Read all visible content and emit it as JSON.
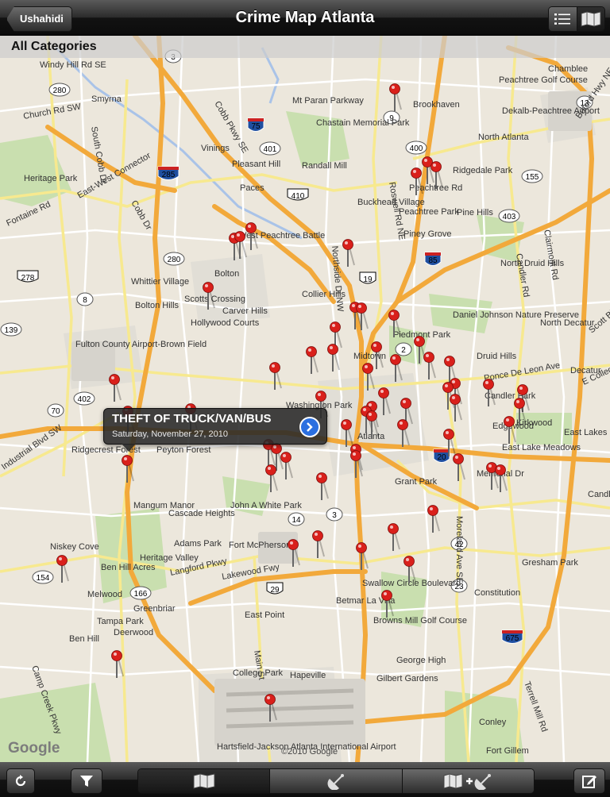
{
  "navbar": {
    "back_label": "Ushahidi",
    "title": "Crime Map Atlanta"
  },
  "category_bar": {
    "label": "All Categories"
  },
  "callout": {
    "title": "THEFT OF TRUCK/VAN/BUS",
    "date": "Saturday, November 27, 2010"
  },
  "map": {
    "attribution_logo": "Google",
    "copyright": "©2010 Google",
    "place_labels": [
      "Smyrna",
      "Vinings",
      "Chamblee",
      "Peachtree Golf Course",
      "Dekalb-Peachtree Airport",
      "Brookhaven",
      "North Atlanta",
      "Ridgedale Park",
      "Pine Hills",
      "Peachtree Park",
      "Piney Grove",
      "Mt Paran Parkway",
      "Chastain Memorial Park",
      "Randall Mill",
      "Pleasant Hill",
      "Paces",
      "Buckhead Village",
      "Heritage Park",
      "West Peachtree Battle",
      "Bolton",
      "North Druid Hills",
      "Whittier Village",
      "Bolton Hills",
      "Scotts Crossing",
      "Carver Hills",
      "Hollywood Courts",
      "Collier Hills",
      "Daniel Johnson Nature Preserve",
      "Piedmont Park",
      "North Decatur",
      "Druid Hills",
      "Decatur",
      "Fulton County Airport-Brown Field",
      "Midtown",
      "Candler Park",
      "Kirkwood",
      "Edgewood",
      "East Lakes",
      "East Lake Meadows",
      "Atlanta",
      "Washington Park",
      "Ridgecrest Forest",
      "Peyton Forest",
      "Grant Park",
      "John A White Park",
      "Cascade Heights",
      "Mangum Manor",
      "Adams Park",
      "Fort McPherson",
      "Betmar La Villa",
      "Swallow Circle Boulevard",
      "Browns Mill Golf Course",
      "Gresham Park",
      "Constitution",
      "Niskey Cove",
      "Ben Hill Acres",
      "Heritage Valley",
      "Melwood",
      "Greenbriar",
      "Tampa Park",
      "Ben Hill",
      "Deerwood",
      "East Point",
      "College Park",
      "Hapeville",
      "George High",
      "Gilbert Gardens",
      "Conley",
      "Fort Gillem",
      "Hartsfield-Jackson Atlanta International Airport",
      "Candl"
    ],
    "road_labels": [
      "Windy Hill Rd SE",
      "Cobb Pkwy SE",
      "East-West Connector",
      "Fontaine Rd",
      "Lakewood Fwy",
      "Langford Pkwy",
      "Ponce De Leon Ave",
      "Moreland Ave SE",
      "Roswell Rd NE",
      "Buford Hwy NE",
      "Peachtree Rd",
      "Northside Dr NW",
      "Cobb Dr",
      "Church Rd SW",
      "South Cobb Dr",
      "Industrial Blvd SW",
      "Camp Creek Pkwy",
      "Candler Rd",
      "Scott Blvd",
      "E College Ave",
      "Clairmont Rd",
      "Memorial Dr",
      "Main St",
      "Terrell Mill Rd"
    ],
    "shields": [
      "3",
      "280",
      "75",
      "401",
      "285",
      "410",
      "280",
      "278",
      "8",
      "139",
      "166",
      "70",
      "402",
      "9",
      "400",
      "13",
      "155",
      "403",
      "85",
      "19",
      "20",
      "14",
      "29",
      "23",
      "42",
      "154",
      "675",
      "2",
      "3"
    ],
    "pin_color": "#d9201b"
  },
  "toolbar": {
    "refresh_icon": "refresh-icon",
    "filter_icon": "filter-icon",
    "segments": [
      "map-view-icon",
      "satellite-icon",
      "hybrid-icon"
    ],
    "compose_icon": "compose-icon"
  }
}
